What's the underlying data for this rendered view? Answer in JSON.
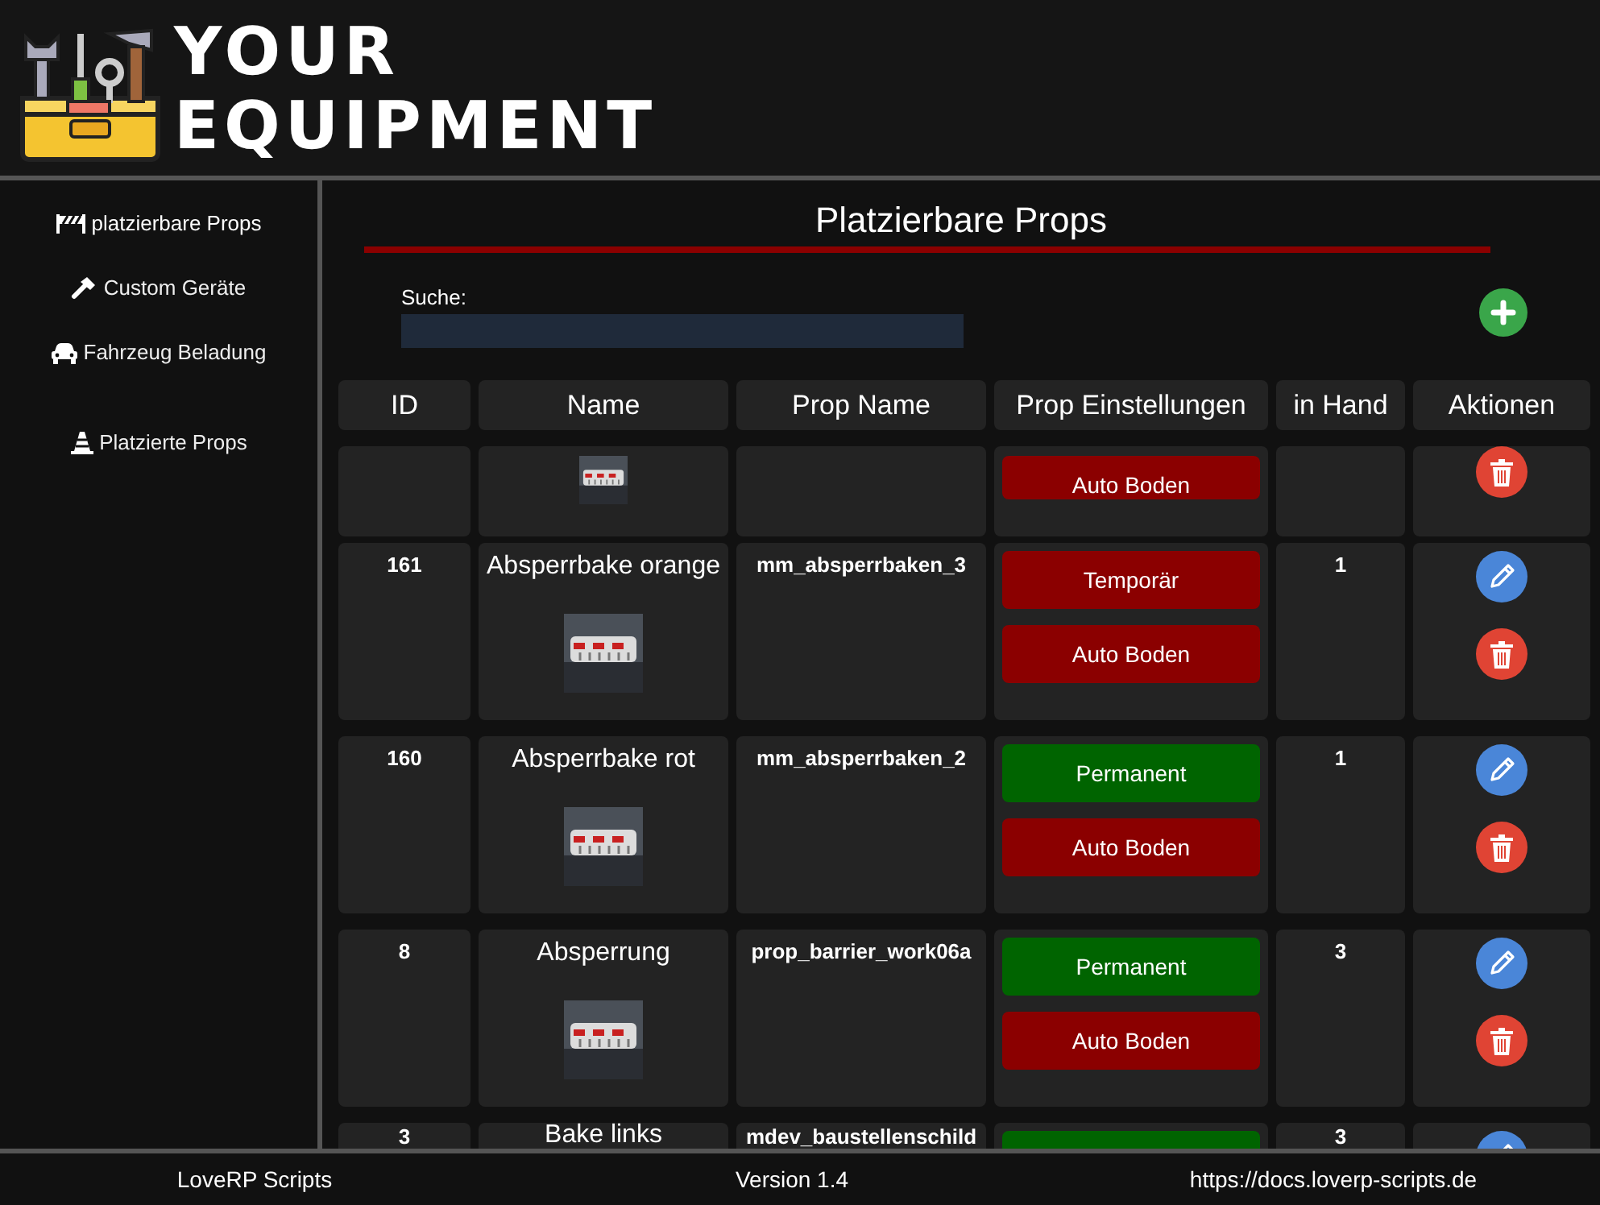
{
  "header": {
    "title_lines": [
      "YOUR",
      "EQUIPMENT"
    ]
  },
  "sidebar": {
    "items": [
      {
        "label": "platzierbare Props",
        "selected": true
      },
      {
        "label": "Custom Geräte",
        "selected": false
      },
      {
        "label": "Fahrzeug Beladung",
        "selected": false
      },
      {
        "label": "Platzierte Props",
        "selected": false
      }
    ]
  },
  "main": {
    "title": "Platzierbare Props",
    "search": {
      "label": "Suche:"
    },
    "table": {
      "columns": [
        "ID",
        "Name",
        "Prop Name",
        "Prop Einstellungen",
        "in Hand",
        "Aktionen"
      ],
      "rows": [
        {
          "kind": "cut_top",
          "settings": [
            {
              "label": "Auto Boden",
              "on": false
            }
          ]
        },
        {
          "kind": "full",
          "id": "161",
          "name": "Absperrbake orange",
          "prop_name": "mm_absperrbaken_3",
          "settings": [
            {
              "label": "Temporär",
              "on": false
            },
            {
              "label": "Auto Boden",
              "on": false
            }
          ],
          "in_hand": "1"
        },
        {
          "kind": "full",
          "id": "160",
          "name": "Absperrbake rot",
          "prop_name": "mm_absperrbaken_2",
          "settings": [
            {
              "label": "Permanent",
              "on": true
            },
            {
              "label": "Auto Boden",
              "on": false
            }
          ],
          "in_hand": "1"
        },
        {
          "kind": "full",
          "id": "8",
          "name": "Absperrung",
          "prop_name": "prop_barrier_work06a",
          "settings": [
            {
              "label": "Permanent",
              "on": true
            },
            {
              "label": "Auto Boden",
              "on": false
            }
          ],
          "in_hand": "3"
        },
        {
          "kind": "cut_bottom",
          "id": "3",
          "name": "Bake links",
          "prop_name": "mdev_baustellenschild",
          "settings": [
            {
              "on": true
            }
          ],
          "in_hand": "3"
        }
      ]
    }
  },
  "footer": {
    "left": "LoveRP Scripts",
    "center": "Version 1.4",
    "right": "https://docs.loverp-scripts.de"
  }
}
